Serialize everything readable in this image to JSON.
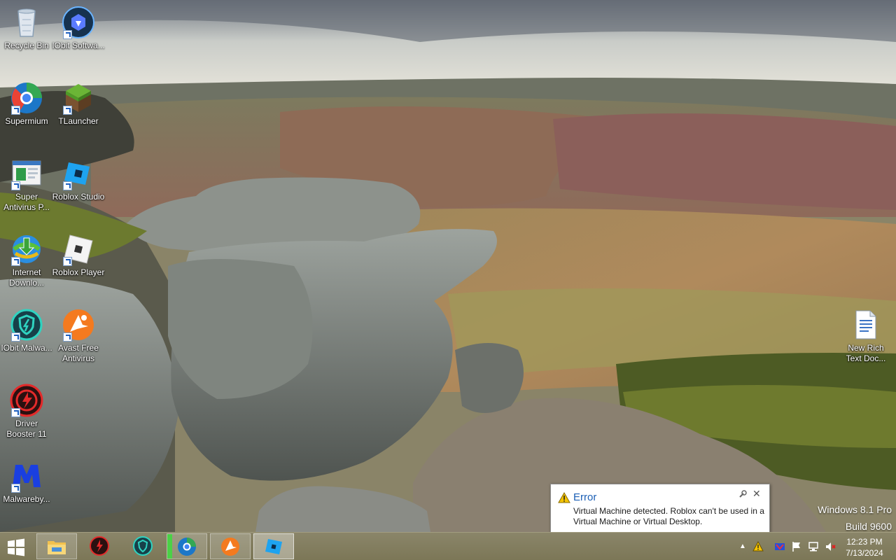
{
  "desktop": {
    "icons": [
      {
        "label": "Recycle Bin",
        "icon": "recycle-bin-icon"
      },
      {
        "label": "IObit Softwa...",
        "icon": "iobit-software-icon"
      },
      {
        "label": "Supermium",
        "icon": "supermium-browser-icon"
      },
      {
        "label": "TLauncher",
        "icon": "tlauncher-grass-block-icon"
      },
      {
        "label": "Super Antivirus P...",
        "icon": "super-antivirus-icon"
      },
      {
        "label": "Roblox Studio",
        "icon": "roblox-studio-icon"
      },
      {
        "label": "Internet Downlo...",
        "icon": "internet-download-manager-icon"
      },
      {
        "label": "Roblox Player",
        "icon": "roblox-player-icon"
      },
      {
        "label": "IObit Malwa...",
        "icon": "iobit-malware-fighter-icon"
      },
      {
        "label": "Avast Free Antivirus",
        "icon": "avast-icon"
      },
      {
        "label": "Driver Booster 11",
        "icon": "driver-booster-icon"
      },
      {
        "label": "Malwareby...",
        "icon": "malwarebytes-icon"
      },
      {
        "label": "New Rich Text Doc...",
        "icon": "rich-text-document-icon"
      }
    ]
  },
  "notification": {
    "title": "Error",
    "message": "Virtual Machine detected. Roblox can't be used in a Virtual Machine or Virtual Desktop.",
    "accent": "#1b5fb5"
  },
  "watermark": {
    "line1": "Windows 8.1 Pro",
    "line2": "Build 9600"
  },
  "taskbar": {
    "items": [
      {
        "name": "file-explorer",
        "icon": "folder-icon"
      },
      {
        "name": "driver-booster",
        "icon": "driver-booster-icon"
      },
      {
        "name": "iobit-malware-fighter",
        "icon": "iobit-malware-fighter-icon"
      },
      {
        "name": "supermium",
        "icon": "supermium-browser-icon"
      },
      {
        "name": "avast",
        "icon": "avast-icon"
      },
      {
        "name": "roblox-studio",
        "icon": "roblox-studio-icon"
      }
    ],
    "clock": {
      "time": "12:23 PM",
      "date": "7/13/2024"
    }
  }
}
